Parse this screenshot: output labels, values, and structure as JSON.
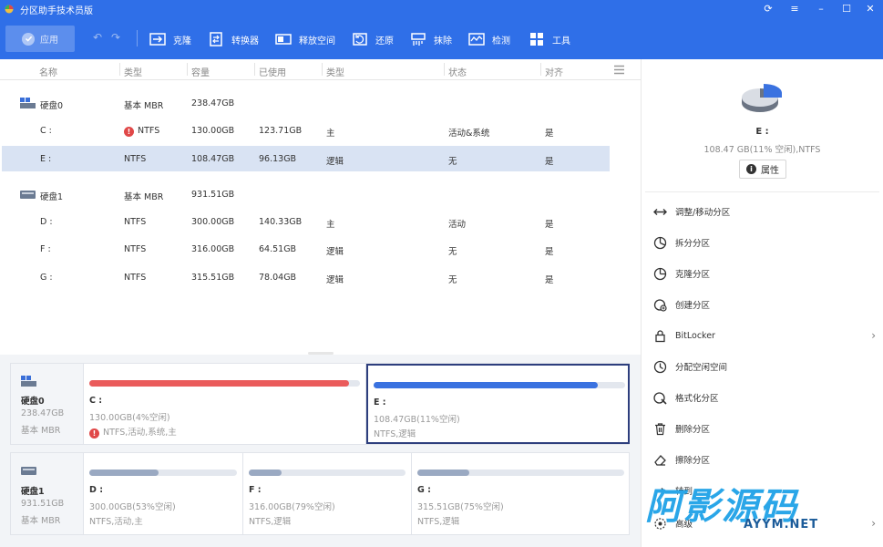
{
  "app": {
    "title": "分区助手技术员版"
  },
  "toolbar": {
    "apply_label": "应用",
    "tools": [
      {
        "label": "克隆",
        "icon": "clone-icon"
      },
      {
        "label": "转换器",
        "icon": "convert-icon"
      },
      {
        "label": "释放空间",
        "icon": "free-space-icon"
      },
      {
        "label": "还原",
        "icon": "restore-icon"
      },
      {
        "label": "抹除",
        "icon": "wipe-icon"
      },
      {
        "label": "检测",
        "icon": "detect-icon"
      },
      {
        "label": "工具",
        "icon": "tools-icon"
      }
    ]
  },
  "table": {
    "headers": [
      "名称",
      "类型",
      "容量",
      "已使用",
      "类型",
      "状态",
      "对齐"
    ],
    "rows": [
      {
        "name": "硬盘0",
        "type": "基本 MBR",
        "capacity": "238.47GB",
        "used": "",
        "ptype": "",
        "status": "",
        "align": ""
      },
      {
        "name": "C :",
        "type": "NTFS",
        "capacity": "130.00GB",
        "used": "123.71GB",
        "ptype": "主",
        "status": "活动&系统",
        "align": "是"
      },
      {
        "name": "E :",
        "type": "NTFS",
        "capacity": "108.47GB",
        "used": "96.13GB",
        "ptype": "逻辑",
        "status": "无",
        "align": "是"
      },
      {
        "name": "硬盘1",
        "type": "基本 MBR",
        "capacity": "931.51GB",
        "used": "",
        "ptype": "",
        "status": "",
        "align": ""
      },
      {
        "name": "D :",
        "type": "NTFS",
        "capacity": "300.00GB",
        "used": "140.33GB",
        "ptype": "主",
        "status": "活动",
        "align": "是"
      },
      {
        "name": "F :",
        "type": "NTFS",
        "capacity": "316.00GB",
        "used": "64.51GB",
        "ptype": "逻辑",
        "status": "无",
        "align": "是"
      },
      {
        "name": "G :",
        "type": "NTFS",
        "capacity": "315.51GB",
        "used": "78.04GB",
        "ptype": "逻辑",
        "status": "无",
        "align": "是"
      }
    ]
  },
  "diskmap": {
    "disk0": {
      "name": "硬盘0",
      "size": "238.47GB",
      "type": "基本 MBR",
      "partitions": [
        {
          "label": "C :",
          "line1": "130.00GB(4%空闲)",
          "line2": "NTFS,活动,系统,主",
          "fill": 0.96,
          "color": "#ea5b5b"
        },
        {
          "label": "E :",
          "line1": "108.47GB(11%空闲)",
          "line2": "NTFS,逻辑",
          "fill": 0.89,
          "color": "#3a72e0"
        }
      ]
    },
    "disk1": {
      "name": "硬盘1",
      "size": "931.51GB",
      "type": "基本 MBR",
      "partitions": [
        {
          "label": "D :",
          "line1": "300.00GB(53%空闲)",
          "line2": "NTFS,活动,主",
          "fill": 0.47,
          "color": "#9aa9c2"
        },
        {
          "label": "F :",
          "line1": "316.00GB(79%空闲)",
          "line2": "NTFS,逻辑",
          "fill": 0.21,
          "color": "#9aa9c2"
        },
        {
          "label": "G :",
          "line1": "315.51GB(75%空闲)",
          "line2": "NTFS,逻辑",
          "fill": 0.25,
          "color": "#9aa9c2"
        }
      ]
    }
  },
  "panel": {
    "selected_name": "E :",
    "selected_info": "108.47 GB(11% 空闲),NTFS",
    "properties_label": "属性",
    "actions": [
      {
        "label": "调整/移动分区",
        "icon": "resize-move-icon"
      },
      {
        "label": "拆分分区",
        "icon": "split-icon"
      },
      {
        "label": "克隆分区",
        "icon": "clone-partition-icon"
      },
      {
        "label": "创建分区",
        "icon": "create-partition-icon"
      },
      {
        "label": "BitLocker",
        "icon": "lock-icon"
      },
      {
        "label": "分配空闲空间",
        "icon": "allocate-space-icon"
      },
      {
        "label": "格式化分区",
        "icon": "format-icon"
      },
      {
        "label": "删除分区",
        "icon": "trash-icon"
      },
      {
        "label": "擦除分区",
        "icon": "eraser-icon"
      },
      {
        "label": "转到...",
        "icon": "goto-icon"
      },
      {
        "label": "高级",
        "icon": "advanced-icon"
      }
    ]
  },
  "watermark": {
    "main": "阿影源码",
    "sub": "AYYM.NET"
  }
}
